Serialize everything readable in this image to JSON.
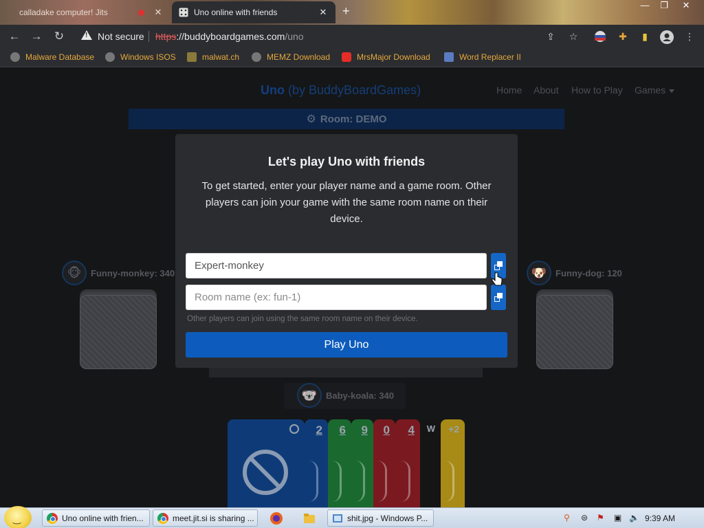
{
  "browser": {
    "tabs": [
      {
        "title": "calladake computer! Jits",
        "active": false
      },
      {
        "title": "Uno online with friends",
        "active": true
      }
    ],
    "security_label": "Not secure",
    "url_scheme": "https",
    "url_host": "://buddyboardgames.com",
    "url_path": "/uno",
    "bookmarks": [
      "Malware Database",
      "Windows ISOS",
      "malwat.ch",
      "MEMZ Download",
      "MrsMajor Download",
      "Word Replacer II"
    ]
  },
  "site": {
    "brand_name": "Uno",
    "brand_suffix": "(by BuddyBoardGames)",
    "nav": [
      "Home",
      "About",
      "How to Play",
      "Games"
    ],
    "room_label": "Room: DEMO"
  },
  "players": {
    "left": "Funny-monkey: 340",
    "right": "Funny-dog: 120",
    "bottom": "Baby-koala: 340"
  },
  "hand": {
    "cards": [
      {
        "color": "blue",
        "label": "⦸"
      },
      {
        "color": "blue",
        "label": "2"
      },
      {
        "color": "green",
        "label": "6"
      },
      {
        "color": "green",
        "label": "9"
      },
      {
        "color": "red",
        "label": "0"
      },
      {
        "color": "red",
        "label": "4"
      },
      {
        "color": "black",
        "label": "W"
      },
      {
        "color": "yellow",
        "label": "+2"
      }
    ]
  },
  "modal": {
    "title": "Let's play Uno with friends",
    "description": "To get started, enter your player name and a game room. Other players can join your game with the same room name on their device.",
    "player_name_value": "Expert-monkey",
    "room_placeholder": "Room name (ex: fun-1)",
    "help_text": "Other players can join using the same room name on their device.",
    "play_button": "Play Uno"
  },
  "taskbar": {
    "items": [
      "Uno online with frien...",
      "meet.jit.si is sharing ...",
      "shit.jpg - Windows P..."
    ],
    "clock": "9:39 AM"
  },
  "colors": {
    "accent": "#0d5cbd",
    "modal_bg": "#2b2c30",
    "page_bg": "#151618"
  }
}
